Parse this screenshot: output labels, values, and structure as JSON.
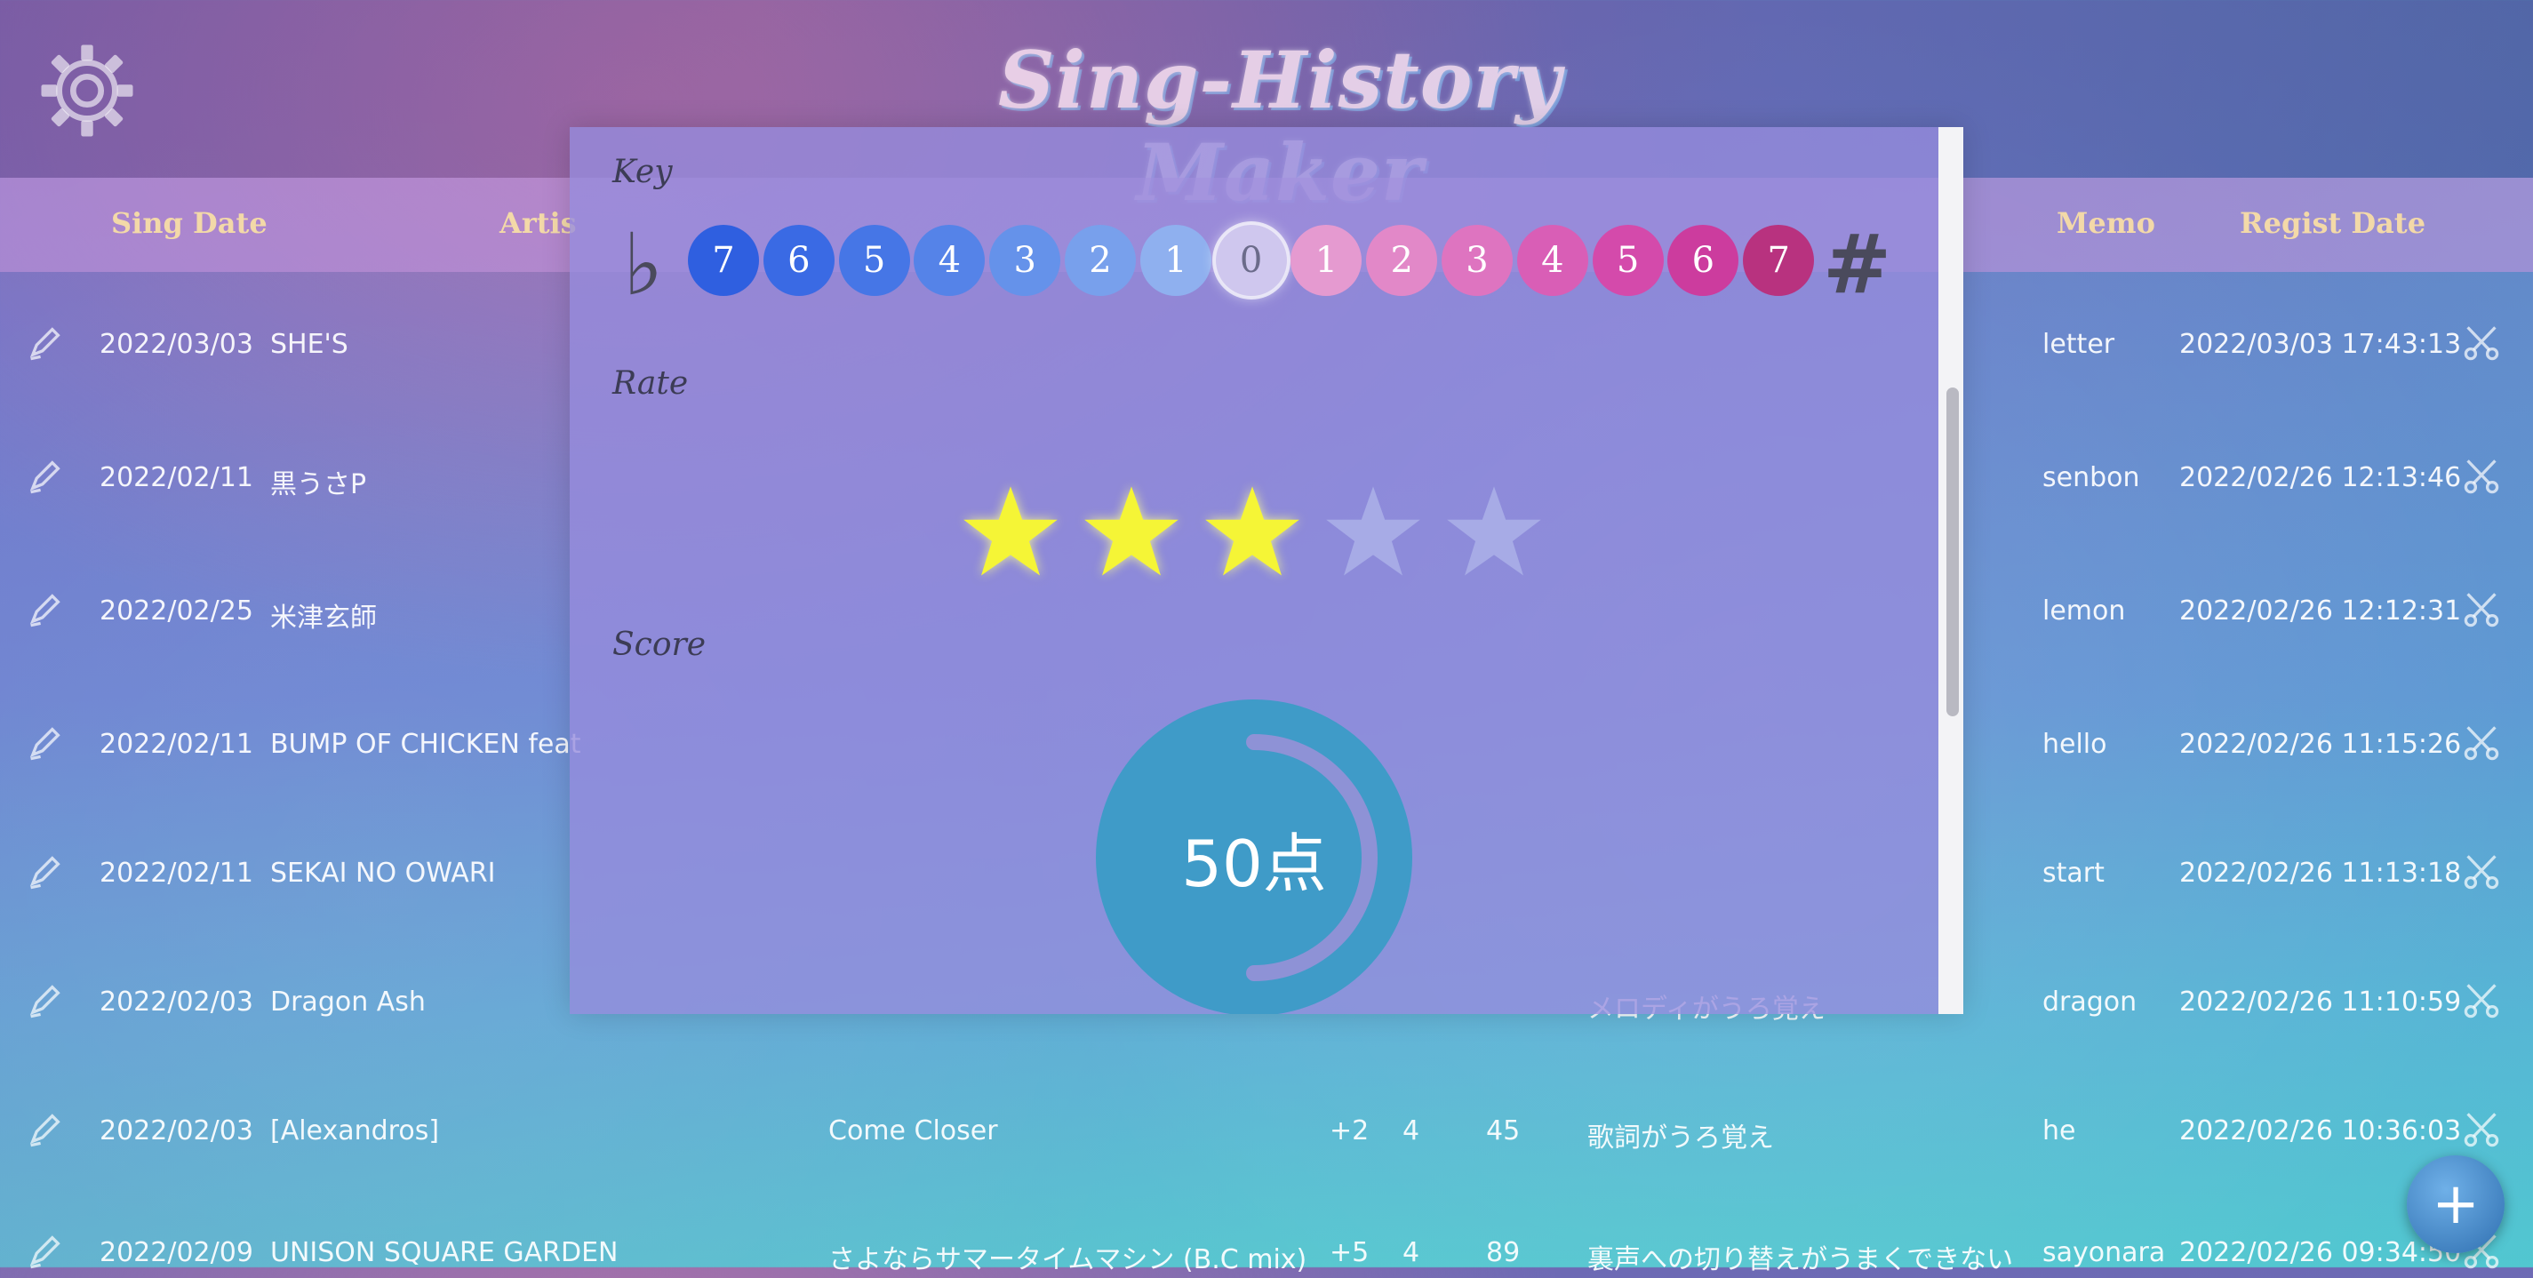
{
  "app": {
    "title": "Sing-History Maker"
  },
  "columns": [
    {
      "label": "Sing Date"
    },
    {
      "label": "Artis"
    },
    {
      "label": "Memo"
    },
    {
      "label": "Regist Date"
    }
  ],
  "rows": [
    {
      "sing_date": "2022/03/03",
      "artist": "SHE'S",
      "memo": "letter",
      "regist_date": "2022/03/03 17:43:13"
    },
    {
      "sing_date": "2022/02/11",
      "artist": "黒うさP",
      "memo": "senbon",
      "regist_date": "2022/02/26 12:13:46"
    },
    {
      "sing_date": "2022/02/25",
      "artist": "米津玄師",
      "memo": "lemon",
      "regist_date": "2022/02/26 12:12:31"
    },
    {
      "sing_date": "2022/02/11",
      "artist": "BUMP OF CHICKEN feat",
      "memo": "hello",
      "regist_date": "2022/02/26 11:15:26"
    },
    {
      "sing_date": "2022/02/11",
      "artist": "SEKAI NO OWARI",
      "memo": "start",
      "regist_date": "2022/02/26 11:13:18"
    },
    {
      "sing_date": "2022/02/03",
      "artist": "Dragon Ash",
      "comment": "メロディがうろ覚え",
      "memo": "dragon",
      "regist_date": "2022/02/26 11:10:59"
    },
    {
      "sing_date": "2022/02/03",
      "artist": "[Alexandros]",
      "song": "Come Closer",
      "key": "+2",
      "rate": "4",
      "score": "45",
      "comment": "歌詞がうろ覚え",
      "memo": "he",
      "regist_date": "2022/02/26 10:36:03"
    },
    {
      "sing_date": "2022/02/09",
      "artist": "UNISON SQUARE GARDEN",
      "song": "さよならサマータイムマシン (B.C mix)",
      "key": "+5",
      "rate": "4",
      "score": "89",
      "comment": "裏声への切り替えがうまくできない",
      "memo": "sayonara",
      "regist_date": "2022/02/26 09:34:50"
    }
  ],
  "modal": {
    "key_label": "Key",
    "rate_label": "Rate",
    "score_label": "Score",
    "flat_symbol": "♭",
    "sharp_symbol": "#",
    "key_options": [
      {
        "label": "7",
        "color": "#2f5fe0"
      },
      {
        "label": "6",
        "color": "#3a6ae4"
      },
      {
        "label": "5",
        "color": "#4676e6"
      },
      {
        "label": "4",
        "color": "#5583e8"
      },
      {
        "label": "3",
        "color": "#6592ea"
      },
      {
        "label": "2",
        "color": "#78a0ec"
      },
      {
        "label": "1",
        "color": "#8fb0ef"
      },
      {
        "label": "0",
        "color": "#cfc7ee"
      },
      {
        "label": "1",
        "color": "#e59ad0"
      },
      {
        "label": "2",
        "color": "#e288c8"
      },
      {
        "label": "3",
        "color": "#de74c0"
      },
      {
        "label": "4",
        "color": "#d95eb6"
      },
      {
        "label": "5",
        "color": "#d44aab"
      },
      {
        "label": "6",
        "color": "#cc3c9e"
      },
      {
        "label": "7",
        "color": "#b8327f"
      }
    ],
    "selected_key": "0",
    "rate": {
      "value": 3,
      "max": 5,
      "on_color": "#f5f536",
      "off_color": "#a7abe6"
    },
    "score": {
      "text": "50点",
      "value": 50,
      "max": 100,
      "gauge_color": "#3f9bc8",
      "track_color": "#8e92d6"
    }
  },
  "fab_label": "+"
}
